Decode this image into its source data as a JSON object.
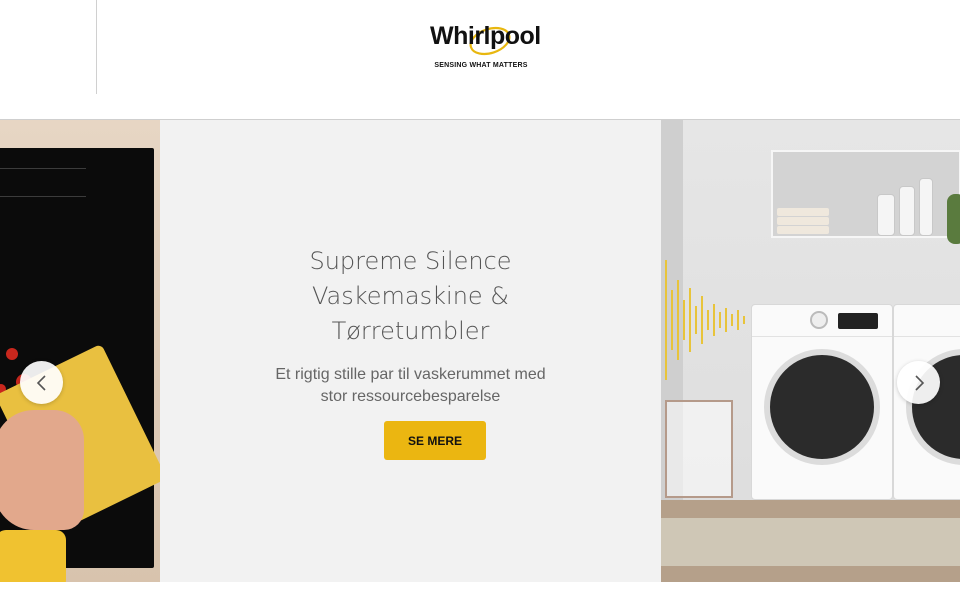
{
  "brand": {
    "name": "Whirlpool",
    "tagline": "SENSING WHAT MATTERS",
    "accent_color": "#ebb611"
  },
  "carousel": {
    "slide": {
      "title_lines": [
        "Supreme Silence",
        "Vaskemaskine &",
        "Tørretumbler"
      ],
      "subtitle_lines": [
        "Et rigtig stille par til vaskerummet med",
        "stor ressourcebesparelse"
      ],
      "cta_label": "SE MERE"
    },
    "prev_icon": "chevron-left-icon",
    "next_icon": "chevron-right-icon"
  }
}
